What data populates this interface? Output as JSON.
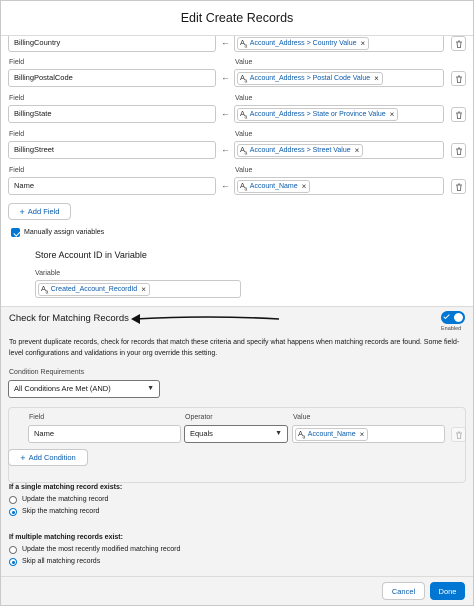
{
  "modal": {
    "title": "Edit Create Records",
    "cancel_label": "Cancel",
    "done_label": "Done"
  },
  "mapping": {
    "field_label": "Field",
    "value_label": "Value",
    "rows": [
      {
        "field": "BillingCountry",
        "value": "Account_Address > Country Value"
      },
      {
        "field": "BillingPostalCode",
        "value": "Account_Address > Postal Code Value"
      },
      {
        "field": "BillingState",
        "value": "Account_Address > State or Province Value"
      },
      {
        "field": "BillingStreet",
        "value": "Account_Address > Street Value"
      },
      {
        "field": "Name",
        "value": "Account_Name"
      }
    ],
    "add_field_label": "Add Field",
    "manual_vars_label": "Manually assign variables",
    "store_id_title": "Store Account ID in Variable",
    "variable_label": "Variable",
    "variable_value": "Created_Account_RecordId"
  },
  "matching": {
    "title": "Check for Matching Records",
    "toggle_state": "Enabled",
    "description": "To prevent duplicate records, check for records that match these criteria and specify what happens when matching records are found. Some field-level configurations and validations in your org override this setting.",
    "condition_req_label": "Condition Requirements",
    "condition_req_value": "All Conditions Are Met (AND)",
    "cond_field_label": "Field",
    "cond_operator_label": "Operator",
    "cond_value_label": "Value",
    "cond_field_value": "Name",
    "cond_operator_value": "Equals",
    "cond_value_value": "Account_Name",
    "add_condition_label": "Add Condition",
    "single_title": "If a single matching record exists:",
    "single_opt_update": "Update the matching record",
    "single_opt_skip": "Skip the matching record",
    "multi_title": "If multiple matching records exist:",
    "multi_opt_update": "Update the most recently modified matching record",
    "multi_opt_skip": "Skip all matching records"
  },
  "icons": {
    "text_type": "text-variable-icon",
    "remove": "close-icon",
    "arrow": "left-arrow-icon",
    "delete": "trash-icon"
  },
  "colors": {
    "brand": "#0176d3",
    "link": "#0b5cab",
    "section_bg": "#f3f3f3"
  }
}
